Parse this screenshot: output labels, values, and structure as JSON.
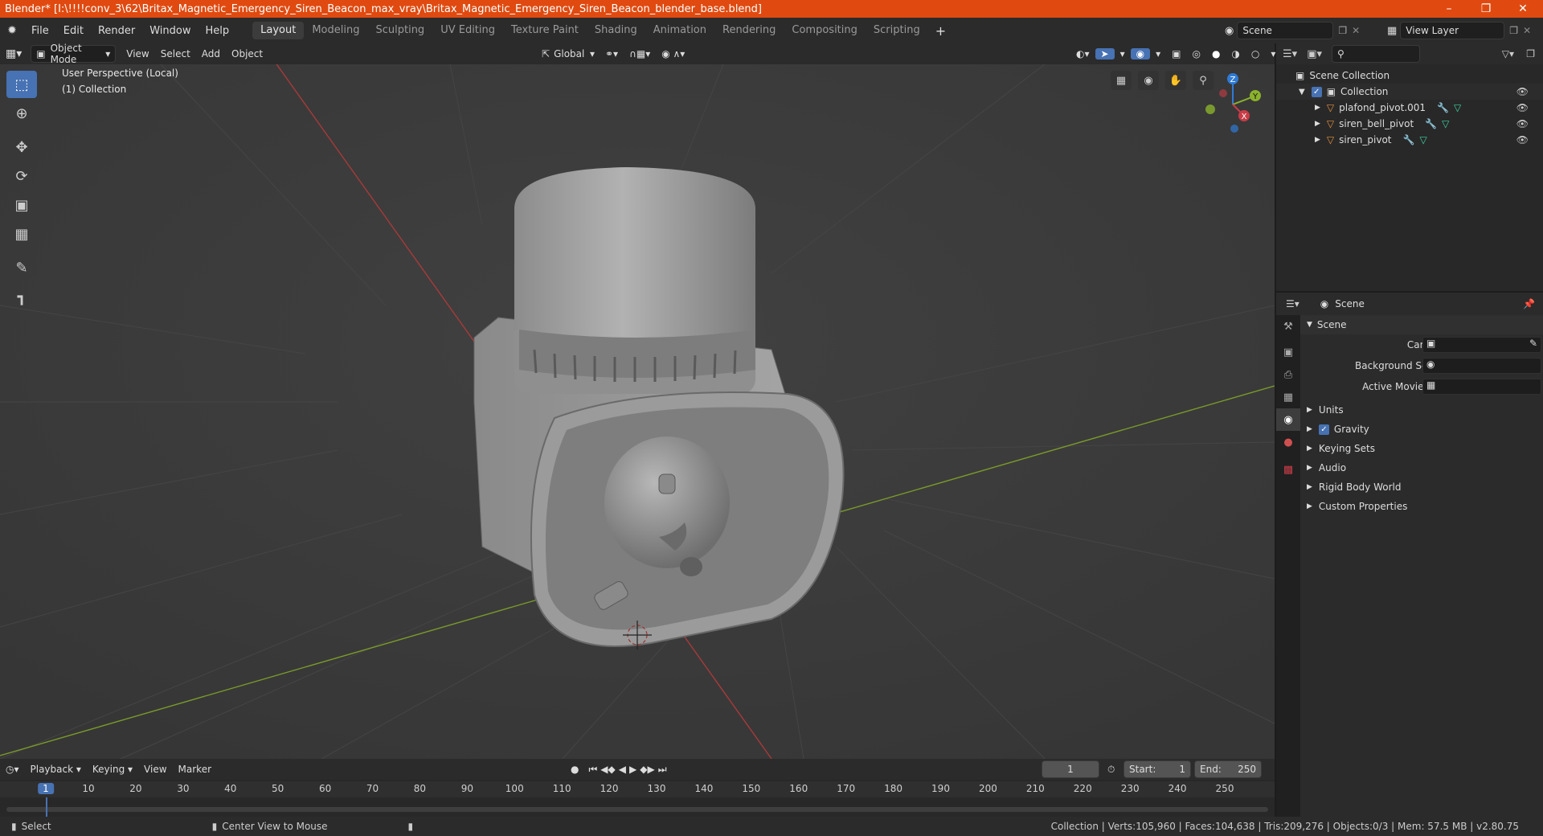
{
  "title": "Blender* [I:\\!!!!conv_3\\62\\Britax_Magnetic_Emergency_Siren_Beacon_max_vray\\Britax_Magnetic_Emergency_Siren_Beacon_blender_base.blend]",
  "menu": [
    "File",
    "Edit",
    "Render",
    "Window",
    "Help"
  ],
  "workspaces": [
    "Layout",
    "Modeling",
    "Sculpting",
    "UV Editing",
    "Texture Paint",
    "Shading",
    "Animation",
    "Rendering",
    "Compositing",
    "Scripting"
  ],
  "scene": "Scene",
  "view_layer": "View Layer",
  "viewport": {
    "mode": "Object Mode",
    "menus": [
      "View",
      "Select",
      "Add",
      "Object"
    ],
    "orientation": "Global",
    "overlay_line1": "User Perspective (Local)",
    "overlay_line2": "(1) Collection",
    "gizmo": {
      "x": "X",
      "y": "Y",
      "z": "Z"
    }
  },
  "outliner": {
    "root": "Scene Collection",
    "collection": "Collection",
    "objects": [
      "plafond_pivot.001",
      "siren_bell_pivot",
      "siren_pivot"
    ]
  },
  "properties": {
    "header": "Scene",
    "panel": "Scene",
    "camera_label": "Camera",
    "bg_scene_label": "Background Scene",
    "movie_clip_label": "Active Movie Clip",
    "sections": [
      "Units",
      "Gravity",
      "Keying Sets",
      "Audio",
      "Rigid Body World",
      "Custom Properties"
    ]
  },
  "timeline": {
    "menus": [
      "Playback",
      "Keying",
      "View",
      "Marker"
    ],
    "current_frame": "1",
    "start_label": "Start:",
    "start": "1",
    "end_label": "End:",
    "end": "250",
    "ruler": [
      "1",
      "10",
      "20",
      "30",
      "40",
      "50",
      "60",
      "70",
      "80",
      "90",
      "100",
      "110",
      "120",
      "130",
      "140",
      "150",
      "160",
      "170",
      "180",
      "190",
      "200",
      "210",
      "220",
      "230",
      "240",
      "250"
    ]
  },
  "status": {
    "left": "Select",
    "middle": "Center View to Mouse",
    "right": "Collection | Verts:105,960 | Faces:104,638 | Tris:209,276 | Objects:0/3 | Mem: 57.5 MB | v2.80.75"
  },
  "colors": {
    "title": "#e04a10",
    "accent": "#4772b3",
    "x_axis": "#c83c46",
    "y_axis": "#8ab22c",
    "z_axis": "#2f7bd6"
  }
}
